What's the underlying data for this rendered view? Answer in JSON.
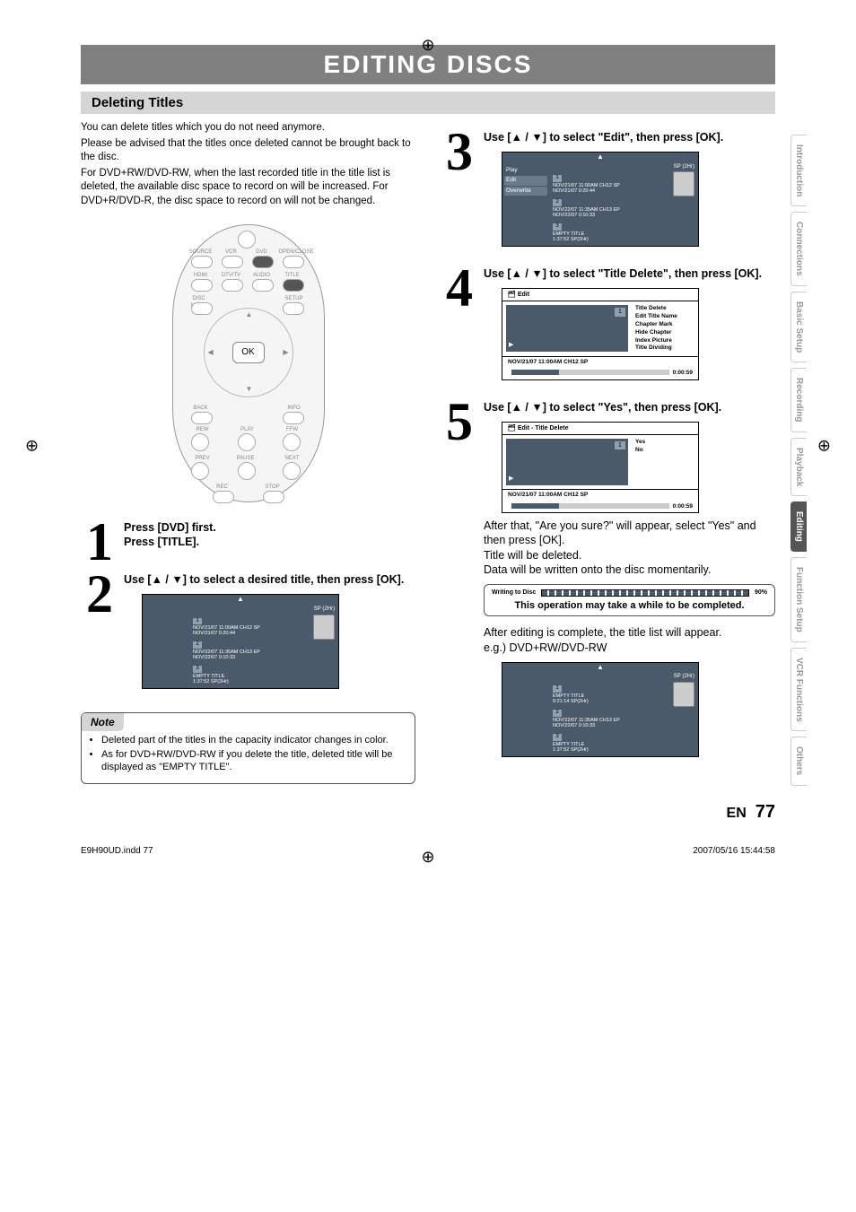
{
  "chapter_title": "EDITING DISCS",
  "section_title": "Deleting Titles",
  "intro": [
    "You can delete titles which you do not need anymore.",
    "Please be advised that the titles once deleted cannot be brought back to the disc.",
    "For DVD+RW/DVD-RW, when the last recorded title in the title list is deleted, the available disc space to record on will be increased. For DVD+R/DVD-R, the disc space to record on will not be changed."
  ],
  "remote": {
    "ok": "OK",
    "labels": {
      "source": "SOURCE",
      "vcr": "VCR",
      "dvd": "DVD",
      "openclose": "OPEN/CLOSE",
      "hdmi": "HDMI",
      "dtv": "DTV/TV",
      "audio": "AUDIO",
      "title": "TITLE",
      "discmenu": "DISC MENU",
      "setup": "SETUP",
      "back": "BACK",
      "info": "INFO",
      "rew": "REW",
      "play": "PLAY",
      "ffw": "FFW",
      "prev": "PREV",
      "pause": "PAUSE",
      "next": "NEXT",
      "rec": "REC",
      "stop": "STOP"
    }
  },
  "steps": {
    "s1": {
      "num": "1",
      "line1": "Press [DVD] first.",
      "line2": "Press [TITLE]."
    },
    "s2": {
      "num": "2",
      "text": "Use [▲ / ▼] to select a desired title, then press [OK]."
    },
    "s3": {
      "num": "3",
      "text": "Use [▲ / ▼] to select \"Edit\", then press [OK]."
    },
    "s4": {
      "num": "4",
      "text": "Use [▲ / ▼] to select \"Title Delete\", then press [OK]."
    },
    "s5": {
      "num": "5",
      "text": "Use [▲ / ▼] to select \"Yes\", then press [OK]."
    }
  },
  "osd_mode": "SP (2Hr)",
  "osd_side": {
    "play": "Play",
    "edit": "Edit",
    "overwrite": "Overwrite"
  },
  "osd_items_a": [
    {
      "n": "1",
      "l1": "NOV/21/07 11:00AM CH12 SP",
      "l2": "NOV/21/07   0:20:44"
    },
    {
      "n": "2",
      "l1": "NOV/22/07 11:35AM CH13 EP",
      "l2": "NOV/22/07   0:10:33"
    },
    {
      "n": "3",
      "l1": "EMPTY TITLE",
      "l2": "1:37:52  SP(2Hr)"
    }
  ],
  "osd_items_c": [
    {
      "n": "1",
      "l1": "EMPTY TITLE",
      "l2": "0:21:14  SP(2Hr)"
    },
    {
      "n": "2",
      "l1": "NOV/22/07 11:35AM CH13 EP",
      "l2": "NOV/22/07   0:10:33"
    },
    {
      "n": "3",
      "l1": "EMPTY TITLE",
      "l2": "1:37:52  SP(2Hr)"
    }
  ],
  "edit_menu": {
    "title": "Edit",
    "items": [
      "Title Delete",
      "Edit Title Name",
      "Chapter Mark",
      "Hide Chapter",
      "Index Picture",
      "Title Dividing"
    ],
    "footer_left": "NOV/21/07 11:00AM CH12 SP",
    "footer_time": "0:00:59"
  },
  "confirm_menu": {
    "title": "Edit - Title Delete",
    "items": [
      "Yes",
      "No"
    ],
    "footer_left": "NOV/21/07 11:00AM CH12 SP",
    "footer_time": "0:00:59"
  },
  "after5": [
    "After that, \"Are you sure?\" will appear, select \"Yes\" and then press [OK].",
    "Title will be deleted.",
    "Data will be written onto the disc momentarily."
  ],
  "writing": {
    "label": "Writing to Disc",
    "pct": "90%"
  },
  "writing_caption": "This operation may take a while to be completed.",
  "after_edit": "After editing is complete, the title list will appear.",
  "eg": "e.g.) DVD+RW/DVD-RW",
  "note": {
    "label": "Note",
    "items": [
      "Deleted part of the titles in the capacity indicator changes in color.",
      "As for DVD+RW/DVD-RW if you delete the title, deleted title will be displayed as \"EMPTY TITLE\"."
    ]
  },
  "sidetabs": [
    "Introduction",
    "Connections",
    "Basic Setup",
    "Recording",
    "Playback",
    "Editing",
    "Function Setup",
    "VCR Functions",
    "Others"
  ],
  "sidetabs_active": "Editing",
  "footer": {
    "file": "E9H90UD.indd   77",
    "date": "2007/05/16   15:44:58",
    "lang": "EN",
    "page": "77"
  }
}
